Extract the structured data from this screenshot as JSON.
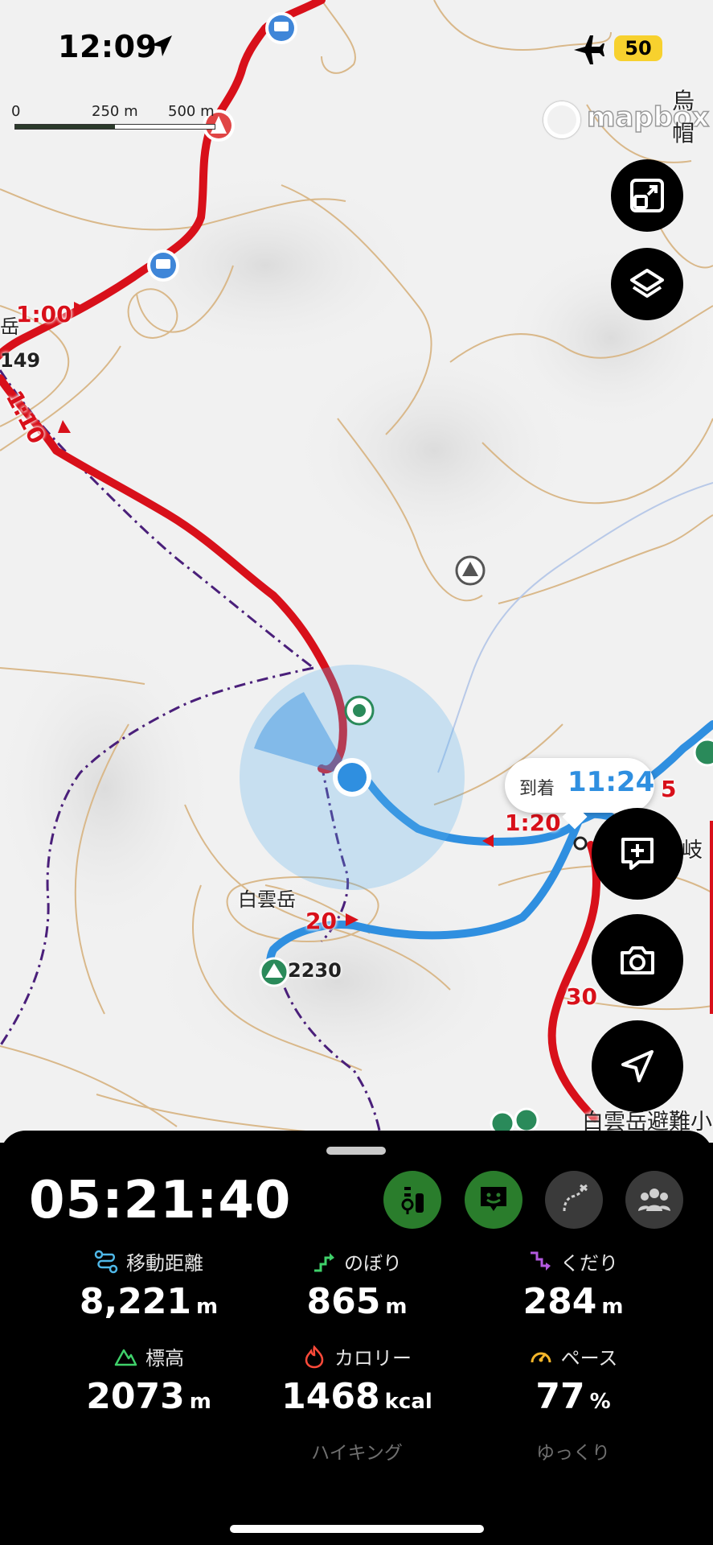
{
  "status_bar": {
    "time": "12:09",
    "battery": "50"
  },
  "map": {
    "scale": {
      "labels": [
        "0",
        "250 m",
        "500 m"
      ]
    },
    "attribution": "mapbox",
    "places": {
      "eboshi": "烏帽",
      "hakuundake": "白雲岳",
      "peak_elev": "2230",
      "hut": "白雲岳避難小",
      "bunki": "岐",
      "dake_left": "岳",
      "elev_left": "149"
    },
    "route_times": [
      "1:00",
      "1:10",
      "1:20",
      "20",
      "30",
      "5"
    ],
    "eta": {
      "label": "到着",
      "time": "11:24"
    }
  },
  "panel": {
    "elapsed": "05:21:40",
    "stats": [
      {
        "label": "移動距離",
        "value": "8,221",
        "unit": "m"
      },
      {
        "label": "のぼり",
        "value": "865",
        "unit": "m"
      },
      {
        "label": "くだり",
        "value": "284",
        "unit": "m"
      },
      {
        "label": "標高",
        "value": "2073",
        "unit": "m"
      },
      {
        "label": "カロリー",
        "value": "1468",
        "unit": "kcal",
        "sub": "ハイキング"
      },
      {
        "label": "ペース",
        "value": "77",
        "unit": "%",
        "sub": "ゆっくり"
      }
    ]
  },
  "colors": {
    "route_red": "#d8101a",
    "track_blue": "#2f8fe0",
    "mode_green": "#2a7d2c",
    "contour": "#d9b88a"
  }
}
